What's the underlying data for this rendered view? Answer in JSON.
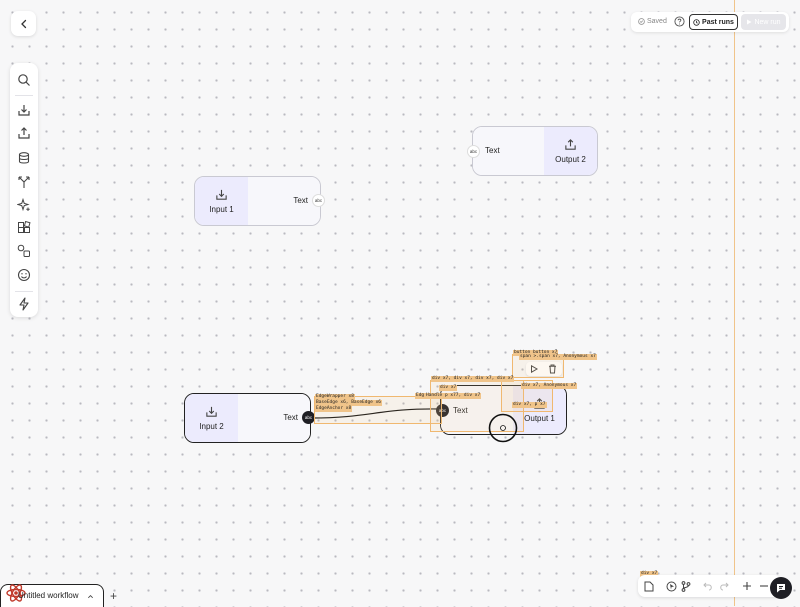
{
  "header": {
    "saved_label": "Saved",
    "past_runs_label": "Past runs",
    "new_run_label": "New run"
  },
  "toolbar": {
    "icons": [
      "search-icon",
      "import-icon",
      "export-icon",
      "database-icon",
      "branch-icon",
      "sparkle-icon",
      "blocks-icon",
      "shapes-icon",
      "emoji-icon",
      "lightning-icon"
    ]
  },
  "nodes": {
    "input1": {
      "label": "Input 1",
      "text": "Text",
      "port": "abc"
    },
    "output2": {
      "label": "Output 2",
      "text": "Text",
      "port": "abc"
    },
    "input2": {
      "label": "Input 2",
      "text": "Text",
      "port": "abc"
    },
    "output1": {
      "label": "Output 1",
      "text": "Text",
      "port": "abc"
    }
  },
  "debug_labels": {
    "edge_wrapper": "EdgeWrapper x8",
    "base_edge": "BaseEdge x6, BaseEdge x6",
    "edge_anchor": "EdgeAnchor x8",
    "edg": "Edg",
    "div_group": "div x7, div x7, div x7, div x7",
    "div_x7": "div x7",
    "handle": "Handle p x77, div x7",
    "button": "button button x7",
    "span_anon": "span >.span x7, Anonymous x7",
    "div_anon": "div x7, Anonymous x7",
    "div_p": "div x7, p x7",
    "div_bottom": "div x7"
  },
  "workflow_tab": {
    "title": "Untitled workflow",
    "add_label": "+"
  },
  "colors": {
    "accent": "#ecebfd",
    "debug": "#f0c48a",
    "dark": "#1e1e24"
  }
}
